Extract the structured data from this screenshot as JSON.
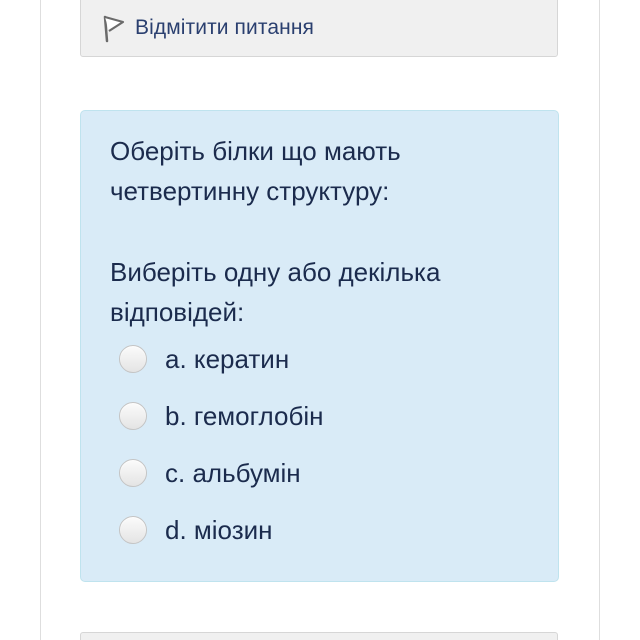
{
  "flag": {
    "label": "Відмітити питання",
    "icon": "flag-icon"
  },
  "question": {
    "text": "Оберіть білки що мають четвертинну структуру:",
    "prompt": "Виберіть одну або декілька відповідей:",
    "answers": [
      {
        "label": "a. кератин",
        "checked": false
      },
      {
        "label": "b. гемоглобін",
        "checked": false
      },
      {
        "label": "c. альбумін",
        "checked": false
      },
      {
        "label": "d. міозин",
        "checked": false
      }
    ]
  },
  "colors": {
    "question_bg": "#d9ebf7",
    "question_border": "#bfe3ee",
    "text": "#1b2b4d",
    "flag_bg": "#f0f0f0"
  }
}
